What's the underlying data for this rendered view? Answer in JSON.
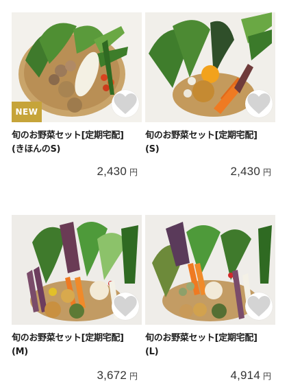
{
  "products": [
    {
      "title_line1": "旬のお野菜セット[定期宅配]",
      "title_line2": "(きほんのS)",
      "price": "2,430",
      "currency": "円",
      "badge": "NEW",
      "favorite_icon": "heart-icon"
    },
    {
      "title_line1": "旬のお野菜セット[定期宅配]",
      "title_line2": "(S)",
      "price": "2,430",
      "currency": "円",
      "favorite_icon": "heart-icon"
    },
    {
      "title_line1": "旬のお野菜セット[定期宅配]",
      "title_line2": "(M)",
      "price": "3,672",
      "currency": "円",
      "favorite_icon": "heart-icon"
    },
    {
      "title_line1": "旬のお野菜セット[定期宅配]",
      "title_line2": "(L)",
      "price": "4,914",
      "currency": "円",
      "favorite_icon": "heart-icon"
    }
  ],
  "colors": {
    "badge_bg": "#c6a43a",
    "heart": "#d4d4d4",
    "text": "#1c1c1c"
  }
}
